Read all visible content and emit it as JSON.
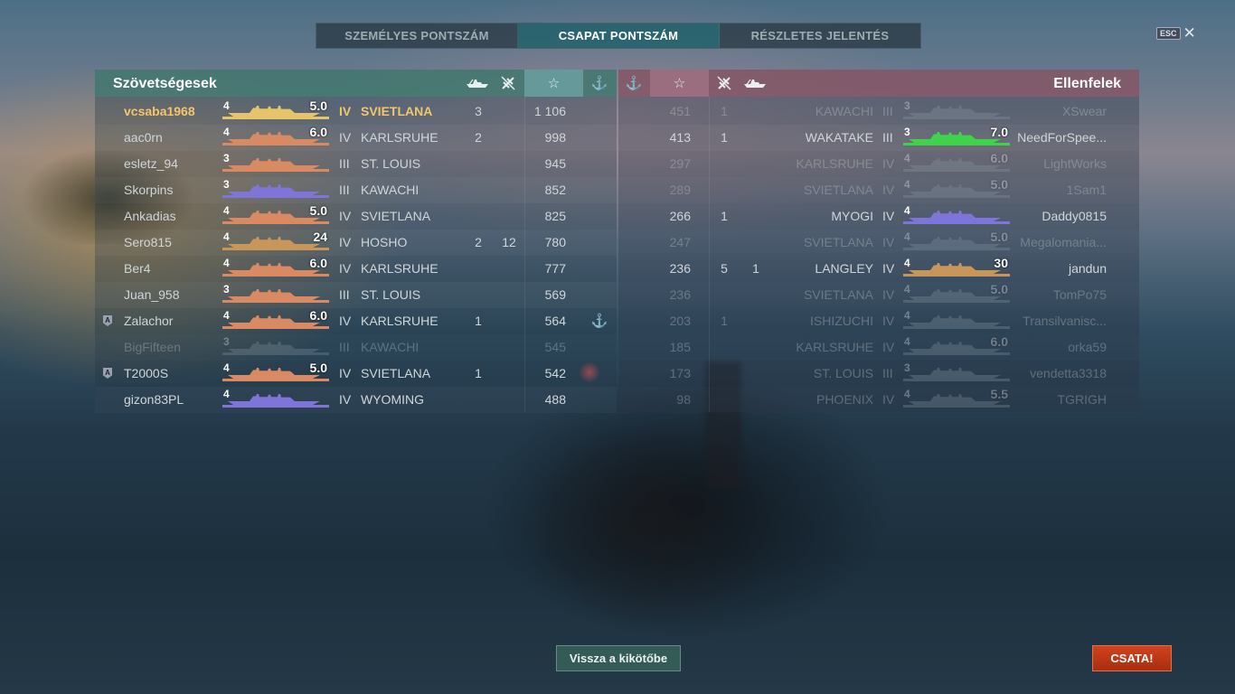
{
  "tabs": [
    {
      "label": "SZEMÉLYES PONTSZÁM",
      "active": false
    },
    {
      "label": "CSAPAT PONTSZÁM",
      "active": true
    },
    {
      "label": "RÉSZLETES JELENTÉS",
      "active": false
    }
  ],
  "esc": {
    "key": "ESC",
    "close": "✕"
  },
  "allies": {
    "title": "Szövetségesek",
    "header_icons": {
      "ship": "ship-kills-icon",
      "plane": "plane-kills-icon",
      "star": "☆",
      "anchor": "⚓"
    },
    "rows": [
      {
        "player": "vcsaba1968",
        "tier": "4",
        "score": "5.0",
        "tier_roman": "IV",
        "ship": "SVIETLANA",
        "kills": "3",
        "planes": "",
        "xp": "1 106",
        "me": true,
        "alive": true,
        "badge": "",
        "anchor": false,
        "color": "#e6c46a"
      },
      {
        "player": "aac0rn",
        "tier": "4",
        "score": "6.0",
        "tier_roman": "IV",
        "ship": "KARLSRUHE",
        "kills": "2",
        "planes": "",
        "xp": "998",
        "me": false,
        "alive": true,
        "badge": "",
        "anchor": false,
        "color": "#d98a63"
      },
      {
        "player": "esletz_94",
        "tier": "3",
        "score": "",
        "tier_roman": "III",
        "ship": "ST. LOUIS",
        "kills": "",
        "planes": "",
        "xp": "945",
        "me": false,
        "alive": true,
        "badge": "",
        "anchor": false,
        "color": "#d98a63"
      },
      {
        "player": "Skorpins",
        "tier": "3",
        "score": "",
        "tier_roman": "III",
        "ship": "KAWACHI",
        "kills": "",
        "planes": "",
        "xp": "852",
        "me": false,
        "alive": true,
        "badge": "",
        "anchor": false,
        "color": "#7f74d8"
      },
      {
        "player": "Ankadias",
        "tier": "4",
        "score": "5.0",
        "tier_roman": "IV",
        "ship": "SVIETLANA",
        "kills": "",
        "planes": "",
        "xp": "825",
        "me": false,
        "alive": true,
        "badge": "",
        "anchor": false,
        "color": "#d98a63"
      },
      {
        "player": "Sero815",
        "tier": "4",
        "score": "24",
        "tier_roman": "IV",
        "ship": "HOSHO",
        "kills": "2",
        "planes": "12",
        "xp": "780",
        "me": false,
        "alive": true,
        "badge": "",
        "anchor": false,
        "color": "#c9965a"
      },
      {
        "player": "Ber4",
        "tier": "4",
        "score": "6.0",
        "tier_roman": "IV",
        "ship": "KARLSRUHE",
        "kills": "",
        "planes": "",
        "xp": "777",
        "me": false,
        "alive": true,
        "badge": "",
        "anchor": false,
        "color": "#d98a63"
      },
      {
        "player": "Juan_958",
        "tier": "3",
        "score": "",
        "tier_roman": "III",
        "ship": "ST. LOUIS",
        "kills": "",
        "planes": "",
        "xp": "569",
        "me": false,
        "alive": true,
        "badge": "",
        "anchor": false,
        "color": "#d98a63"
      },
      {
        "player": "Zalachor",
        "tier": "4",
        "score": "6.0",
        "tier_roman": "IV",
        "ship": "KARLSRUHE",
        "kills": "1",
        "planes": "",
        "xp": "564",
        "me": false,
        "alive": true,
        "badge": "A",
        "anchor": true,
        "color": "#d98a63"
      },
      {
        "player": "BigFifteen",
        "tier": "3",
        "score": "",
        "tier_roman": "III",
        "ship": "KAWACHI",
        "kills": "",
        "planes": "",
        "xp": "545",
        "me": false,
        "alive": false,
        "badge": "",
        "anchor": false,
        "color": "#8a9aa5"
      },
      {
        "player": "T2000S",
        "tier": "4",
        "score": "5.0",
        "tier_roman": "IV",
        "ship": "SVIETLANA",
        "kills": "1",
        "planes": "",
        "xp": "542",
        "me": false,
        "alive": true,
        "badge": "A",
        "anchor": false,
        "color": "#d98a63"
      },
      {
        "player": "gizon83PL",
        "tier": "4",
        "score": "",
        "tier_roman": "IV",
        "ship": "WYOMING",
        "kills": "",
        "planes": "",
        "xp": "488",
        "me": false,
        "alive": true,
        "badge": "",
        "anchor": false,
        "color": "#7f74d8"
      }
    ]
  },
  "enemies": {
    "title": "Ellenfelek",
    "header_icons": {
      "ship": "ship-kills-icon",
      "plane": "plane-kills-icon",
      "star": "☆",
      "anchor": "⚓"
    },
    "rows": [
      {
        "xp": "451",
        "kills": "1",
        "planes": "",
        "ship": "KAWACHI",
        "tier_roman": "III",
        "tier": "3",
        "score": "",
        "player": "XSwear",
        "alive": false,
        "color": "#8a9aa5"
      },
      {
        "xp": "413",
        "kills": "1",
        "planes": "",
        "ship": "WAKATAKE",
        "tier_roman": "III",
        "tier": "3",
        "score": "7.0",
        "player": "NeedForSpee...",
        "alive": true,
        "color": "#3fd34a"
      },
      {
        "xp": "297",
        "kills": "",
        "planes": "",
        "ship": "KARLSRUHE",
        "tier_roman": "IV",
        "tier": "4",
        "score": "6.0",
        "player": "LightWorks",
        "alive": false,
        "color": "#8a9aa5"
      },
      {
        "xp": "289",
        "kills": "",
        "planes": "",
        "ship": "SVIETLANA",
        "tier_roman": "IV",
        "tier": "4",
        "score": "5.0",
        "player": "1Sam1",
        "alive": false,
        "color": "#8a9aa5"
      },
      {
        "xp": "266",
        "kills": "1",
        "planes": "",
        "ship": "MYOGI",
        "tier_roman": "IV",
        "tier": "4",
        "score": "",
        "player": "Daddy0815",
        "alive": true,
        "color": "#7f74d8"
      },
      {
        "xp": "247",
        "kills": "",
        "planes": "",
        "ship": "SVIETLANA",
        "tier_roman": "IV",
        "tier": "4",
        "score": "5.0",
        "player": "Megalomania...",
        "alive": false,
        "color": "#8a9aa5"
      },
      {
        "xp": "236",
        "kills": "5",
        "planes": "1",
        "ship": "LANGLEY",
        "tier_roman": "IV",
        "tier": "4",
        "score": "30",
        "player": "jandun",
        "alive": true,
        "color": "#c9965a"
      },
      {
        "xp": "236",
        "kills": "",
        "planes": "",
        "ship": "SVIETLANA",
        "tier_roman": "IV",
        "tier": "4",
        "score": "5.0",
        "player": "TomPo75",
        "alive": false,
        "color": "#8a9aa5"
      },
      {
        "xp": "203",
        "kills": "1",
        "planes": "",
        "ship": "ISHIZUCHI",
        "tier_roman": "IV",
        "tier": "4",
        "score": "",
        "player": "Transilvanisc...",
        "alive": false,
        "color": "#8a9aa5"
      },
      {
        "xp": "185",
        "kills": "",
        "planes": "",
        "ship": "KARLSRUHE",
        "tier_roman": "IV",
        "tier": "4",
        "score": "6.0",
        "player": "orka59",
        "alive": false,
        "color": "#8a9aa5"
      },
      {
        "xp": "173",
        "kills": "",
        "planes": "",
        "ship": "ST. LOUIS",
        "tier_roman": "III",
        "tier": "3",
        "score": "",
        "player": "vendetta3318",
        "alive": false,
        "color": "#8a9aa5"
      },
      {
        "xp": "98",
        "kills": "",
        "planes": "",
        "ship": "PHOENIX",
        "tier_roman": "IV",
        "tier": "4",
        "score": "5.5",
        "player": "TGRIGH",
        "alive": false,
        "color": "#8a9aa5"
      }
    ]
  },
  "buttons": {
    "back": "Vissza a kikötőbe",
    "battle": "CSATA!"
  }
}
